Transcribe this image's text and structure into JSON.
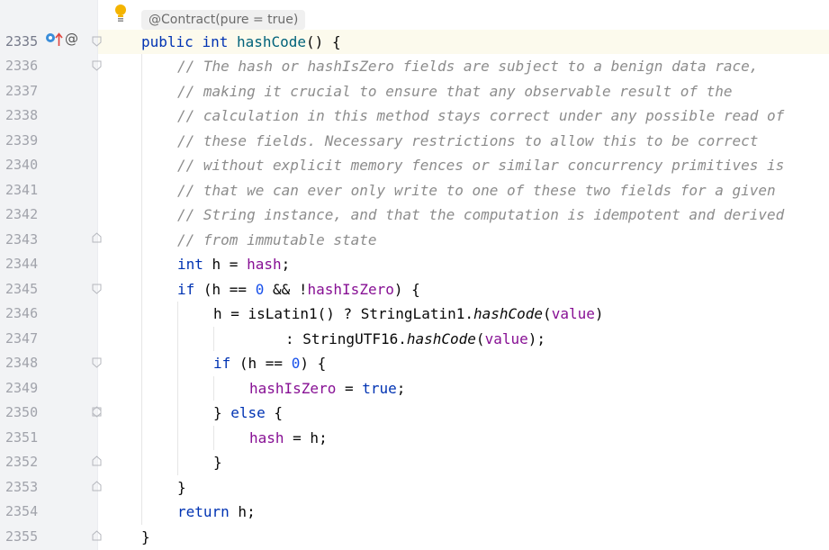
{
  "editor": {
    "inlay_hint": "@Contract(pure = true)",
    "gutter_icons": [
      "intention-bulb-icon",
      "implementation-icon",
      "overrides-arrow-icon",
      "annotation-icon"
    ],
    "line_numbers": [
      "2335",
      "2336",
      "2337",
      "2338",
      "2339",
      "2340",
      "2341",
      "2342",
      "2343",
      "2344",
      "2345",
      "2346",
      "2347",
      "2348",
      "2349",
      "2350",
      "2351",
      "2352",
      "2353",
      "2354",
      "2355"
    ],
    "annotation_marker": "@",
    "colors": {
      "keyword": "#0033b3",
      "comment": "#8c8c8c",
      "field": "#871094",
      "number": "#1750eb",
      "method_decl": "#00627a",
      "current_line": "#fcfaed"
    },
    "code": {
      "sig_public": "public",
      "sig_int": "int",
      "sig_name": "hashCode",
      "sig_rest": "() {",
      "c1": "// The hash or hashIsZero fields are subject to a benign data race,",
      "c2": "// making it crucial to ensure that any observable result of the",
      "c3": "// calculation in this method stays correct under any possible read of",
      "c4": "// these fields. Necessary restrictions to allow this to be correct",
      "c5": "// without explicit memory fences or similar concurrency primitives is",
      "c6": "// that we can ever only write to one of these two fields for a given",
      "c7": "// String instance, and that the computation is idempotent and derived",
      "c8": "// from immutable state",
      "l10_kw": "int",
      "l10_a": " h = ",
      "l10_f": "hash",
      "l10_b": ";",
      "l11_kw": "if",
      "l11_a": " (h == ",
      "l11_n": "0",
      "l11_b": " && !",
      "l11_f": "hashIsZero",
      "l11_c": ") {",
      "l12_a": "h = isLatin1() ? StringLatin1.",
      "l12_m": "hashCode",
      "l12_b": "(",
      "l12_f": "value",
      "l12_c": ")",
      "l13_a": ": StringUTF16.",
      "l13_m": "hashCode",
      "l13_b": "(",
      "l13_f": "value",
      "l13_c": ");",
      "l14_kw": "if",
      "l14_a": " (h == ",
      "l14_n": "0",
      "l14_b": ") {",
      "l15_f": "hashIsZero",
      "l15_a": " = ",
      "l15_kw": "true",
      "l15_b": ";",
      "l16_a": "} ",
      "l16_kw": "else",
      "l16_b": " {",
      "l17_f": "hash",
      "l17_a": " = h;",
      "l18": "}",
      "l19": "}",
      "l20_kw": "return",
      "l20_a": " h;",
      "l21": "}"
    }
  }
}
